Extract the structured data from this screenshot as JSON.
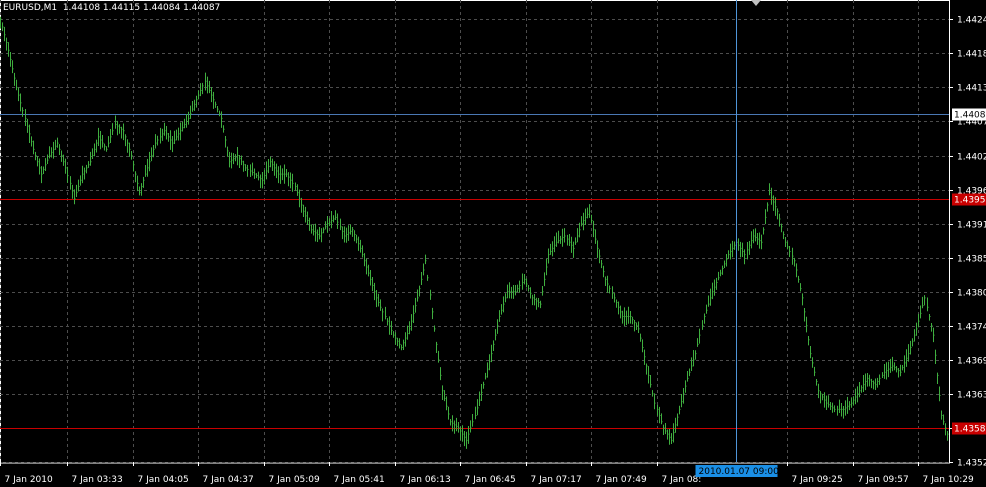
{
  "window": {
    "header": "EURUSD,M1  1.44108 1.44115 1.44084 1.44087"
  },
  "colors": {
    "background": "#000000",
    "grid": "#4d4d4d",
    "candles": "#3fae3f",
    "axis_text": "#ffffff",
    "bid_line": "#4a78b4",
    "level_line": "#c80000",
    "crosshair": "#4f95d8",
    "time_badge": "#1a8fe6"
  },
  "chart_data": {
    "type": "line",
    "symbol": "EURUSD",
    "timeframe": "M1",
    "ohlc": {
      "open": 1.44108,
      "high": 1.44115,
      "low": 1.44084,
      "close": 1.44087
    },
    "ylim": [
      1.43525,
      1.44255
    ],
    "y_ticks": [
      "1.44240",
      "1.44185",
      "1.44130",
      "1.44075",
      "1.44020",
      "1.43965",
      "1.43910",
      "1.43855",
      "1.43800",
      "1.43745",
      "1.43690",
      "1.43635",
      "1.43580",
      "1.43525"
    ],
    "y_tick_values": [
      1.4424,
      1.44185,
      1.4413,
      1.44075,
      1.4402,
      1.43965,
      1.4391,
      1.43855,
      1.438,
      1.43745,
      1.4369,
      1.43635,
      1.4358,
      1.43525
    ],
    "x_ticks": [
      "7 Jan 2010",
      "7 Jan 03:33",
      "7 Jan 04:05",
      "7 Jan 04:37",
      "7 Jan 05:09",
      "7 Jan 05:41",
      "7 Jan 06:13",
      "7 Jan 06:45",
      "7 Jan 07:17",
      "7 Jan 07:49",
      "7 Jan 08:",
      "7 Jan 09:25",
      "7 Jan 09:57",
      "7 Jan 10:29"
    ],
    "x_tick_minutes": [
      180,
      213,
      245,
      277,
      309,
      341,
      373,
      405,
      437,
      469,
      501,
      565,
      597,
      629
    ],
    "xlim_minutes": [
      180,
      644
    ],
    "price_labels": [
      {
        "value": 1.44087,
        "text": "1.44087",
        "kind": "bid"
      },
      {
        "value": 1.4395,
        "text": "1.43950",
        "kind": "level"
      },
      {
        "value": 1.4358,
        "text": "1.43580",
        "kind": "level"
      }
    ],
    "crosshair": {
      "minute": 540,
      "label": "2010.01.07 09:00"
    },
    "series": [
      {
        "x": [
          180,
          184,
          188,
          192,
          196,
          200,
          204,
          208,
          212,
          216,
          220,
          224,
          228,
          232,
          236,
          240,
          244,
          248,
          252,
          256,
          260,
          264,
          268,
          272,
          276,
          280,
          284,
          288,
          292,
          296,
          300,
          304,
          308,
          312,
          316,
          320,
          324,
          328,
          332,
          336,
          340,
          344,
          348,
          352,
          356,
          360,
          364,
          368,
          372,
          376,
          380,
          384,
          388,
          392,
          396,
          400,
          404,
          408,
          412,
          416,
          420,
          424,
          428,
          432,
          436,
          440,
          444,
          448,
          452,
          456,
          460,
          464,
          468,
          472,
          476,
          480,
          484,
          488,
          492,
          496,
          500,
          504,
          508,
          512,
          516,
          520,
          524,
          528,
          532,
          536,
          540,
          544,
          548,
          552,
          556,
          560,
          564,
          568,
          572,
          576,
          580,
          584,
          588,
          592,
          596,
          600,
          604,
          608,
          612,
          616,
          620,
          624,
          628,
          632,
          636,
          640,
          644
        ],
        "y": [
          1.4424,
          1.4419,
          1.4413,
          1.4408,
          1.4403,
          1.4399,
          1.4402,
          1.4404,
          1.44,
          1.4395,
          1.4399,
          1.4401,
          1.4405,
          1.4403,
          1.4407,
          1.4406,
          1.4402,
          1.4396,
          1.44,
          1.4404,
          1.4406,
          1.4404,
          1.4406,
          1.4408,
          1.4411,
          1.4414,
          1.4411,
          1.4408,
          1.4401,
          1.4402,
          1.44,
          1.4399,
          1.4398,
          1.4401,
          1.4399,
          1.4399,
          1.4397,
          1.4393,
          1.439,
          1.4389,
          1.4391,
          1.4392,
          1.4389,
          1.439,
          1.4387,
          1.4383,
          1.4379,
          1.4376,
          1.4373,
          1.4371,
          1.4374,
          1.4379,
          1.4385,
          1.4374,
          1.4364,
          1.4359,
          1.4358,
          1.4356,
          1.436,
          1.4365,
          1.437,
          1.4376,
          1.438,
          1.438,
          1.4382,
          1.4379,
          1.4378,
          1.4386,
          1.4388,
          1.4389,
          1.4387,
          1.4391,
          1.4393,
          1.4387,
          1.4382,
          1.4379,
          1.4376,
          1.4376,
          1.4374,
          1.4368,
          1.4362,
          1.4358,
          1.4356,
          1.4361,
          1.4366,
          1.437,
          1.4376,
          1.438,
          1.4383,
          1.4386,
          1.4388,
          1.4386,
          1.4389,
          1.4388,
          1.4396,
          1.4393,
          1.4388,
          1.4385,
          1.4379,
          1.437,
          1.4364,
          1.4362,
          1.4361,
          1.4361,
          1.4362,
          1.4364,
          1.4366,
          1.4365,
          1.4367,
          1.4368,
          1.4367,
          1.437,
          1.4374,
          1.4379,
          1.4373,
          1.436,
          1.4356
        ]
      }
    ]
  }
}
